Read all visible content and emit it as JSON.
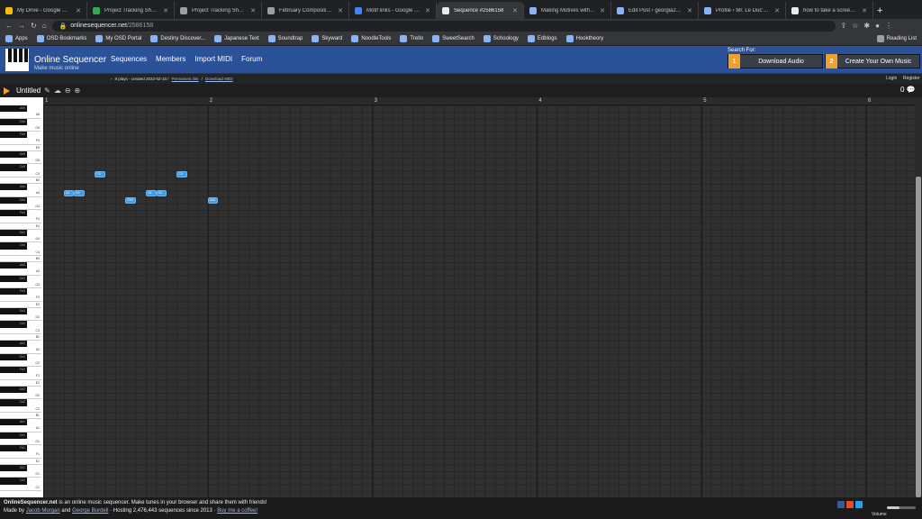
{
  "browser": {
    "tabs": [
      {
        "title": "My Drive - Google Drive",
        "color": "#fbbc04"
      },
      {
        "title": "Project Tracking Sheet - F",
        "color": "#34a853"
      },
      {
        "title": "Project Tracking Sheet: V",
        "color": "#9aa0a6"
      },
      {
        "title": "February Composition Pr",
        "color": "#9aa0a6"
      },
      {
        "title": "Motif links - Google Docs",
        "color": "#4285f4"
      },
      {
        "title": "Sequence #2586158",
        "color": "#e8eaed",
        "active": true
      },
      {
        "title": "Making Motives with Tria",
        "color": "#8ab4f8"
      },
      {
        "title": "Edit Post ‹ georgia22 — V",
        "color": "#8ab4f8"
      },
      {
        "title": "Profile ‹ Mr. Le Duc's Cla",
        "color": "#8ab4f8"
      },
      {
        "title": "how to take a screensh",
        "color": "#e8eaed"
      }
    ],
    "url_host": "onlinesequencer.net",
    "url_path": "/2586158",
    "bookmarks": [
      "Apps",
      "OSD Bookmarks",
      "My OSD Portal",
      "Destiny Discover...",
      "Japanese Text",
      "Soundtrap",
      "Skyward",
      "NoodleTools",
      "Trello",
      "SweetSearch",
      "Schoology",
      "Edblogs",
      "Hooktheory"
    ],
    "reading_list": "Reading List"
  },
  "site": {
    "brand": "Online Sequencer",
    "tagline": "Make music online",
    "nav": [
      "Sequences",
      "Members",
      "Import MIDI",
      "Forum"
    ],
    "search_for": "Search For:",
    "step1_num": "1",
    "step1": "Download Audio",
    "step2_num": "2",
    "step2": "Create Your Own Music",
    "info": "8 plays - created 2022-02-15 /",
    "permanent_link": "Permanent link",
    "download_midi": "Download MIDI",
    "login": "Login",
    "register": "Register"
  },
  "editor": {
    "title": "Untitled",
    "count": "0",
    "measures": [
      "1",
      "2",
      "3",
      "4",
      "5",
      "6"
    ],
    "keys": [
      "A#5",
      "A5",
      "G#5",
      "G5",
      "F#5",
      "F5",
      "E5",
      "D#5",
      "D5",
      "C#5",
      "C5",
      "B4",
      "A#4",
      "A4",
      "G#4",
      "G4",
      "F#4",
      "F4",
      "E4",
      "D#4",
      "D4",
      "C#4",
      "C4",
      "B3",
      "A#3",
      "A3",
      "G#3",
      "G3",
      "F#3",
      "F3",
      "E3",
      "D#3",
      "D3",
      "C#3",
      "C3",
      "B2",
      "A#2",
      "A2",
      "G#2",
      "G2",
      "F#2",
      "F2",
      "E2",
      "D#2",
      "D2",
      "C#2",
      "C2",
      "B1",
      "A#1",
      "A1",
      "G#1",
      "G1",
      "F#1",
      "F1",
      "E1",
      "D#1",
      "D1",
      "C#1",
      "C1"
    ],
    "notes": [
      {
        "label": "C5",
        "step": 5,
        "len": 1
      },
      {
        "label": "C5",
        "step": 13,
        "len": 1
      },
      {
        "label": "A4",
        "step": 2,
        "len": 1
      },
      {
        "label": "A4",
        "step": 3,
        "len": 1
      },
      {
        "label": "A4",
        "step": 10,
        "len": 1
      },
      {
        "label": "A4",
        "step": 11,
        "len": 1
      },
      {
        "label": "G#4",
        "step": 8,
        "len": 1
      },
      {
        "label": "G#4",
        "step": 16,
        "len": 1
      }
    ]
  },
  "footer": {
    "site": "OnlineSequencer.net",
    "desc": " is an online music sequencer. Make tunes in your browser and share them with friends!",
    "made_by": "Made by ",
    "author1": "Jacob Morgan",
    "and": " and ",
    "author2": "George Burdell",
    "hosting": " · Hosting 2,476,443 sequences since 2013 · ",
    "coffee": "Buy me a coffee!",
    "volume": "Volume"
  }
}
